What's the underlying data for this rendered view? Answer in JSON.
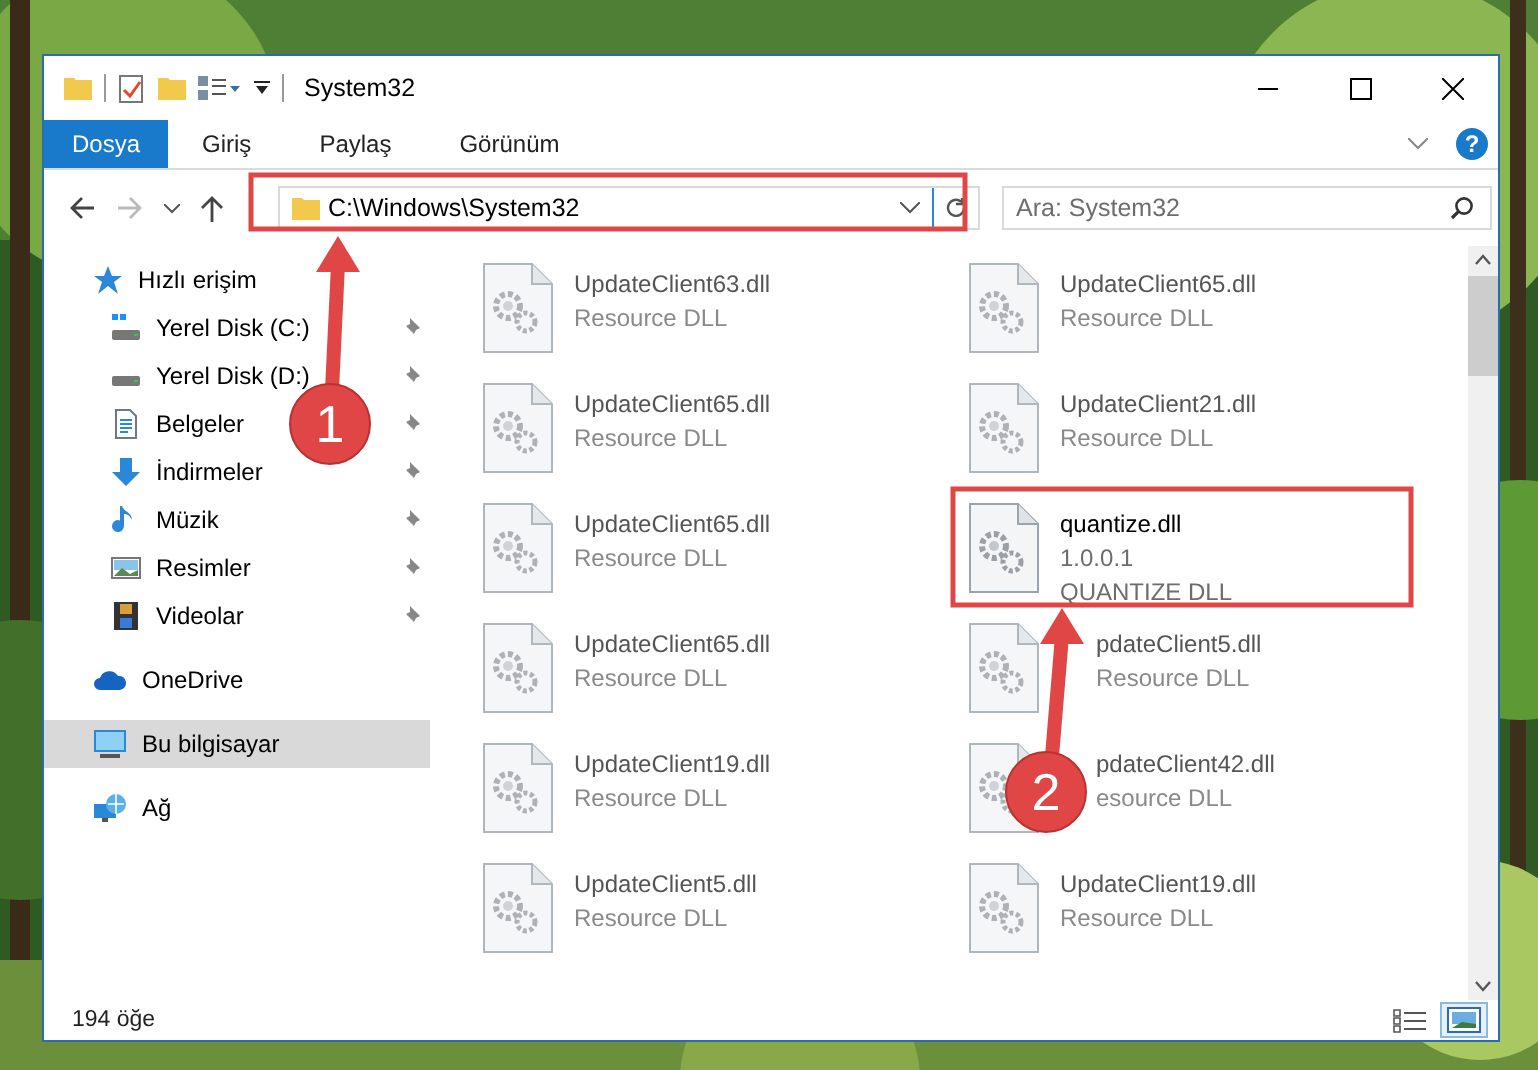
{
  "window": {
    "title": "System32"
  },
  "ribbon_tabs": [
    {
      "label": "Dosya",
      "selected": true
    },
    {
      "label": "Giriş",
      "selected": false
    },
    {
      "label": "Paylaş",
      "selected": false
    },
    {
      "label": "Görünüm",
      "selected": false
    }
  ],
  "help": "?",
  "address": {
    "value": "C:\\Windows\\System32"
  },
  "search": {
    "placeholder": "Ara: System32"
  },
  "sidebar": {
    "items": [
      {
        "kind": "quick-access",
        "label": "Hızlı erişim",
        "selected": false,
        "children": [
          {
            "kind": "disk-c",
            "label": "Yerel Disk (C:)",
            "pinned": true
          },
          {
            "kind": "disk",
            "label": "Yerel Disk (D:)",
            "pinned": true
          },
          {
            "kind": "documents",
            "label": "Belgeler",
            "pinned": true
          },
          {
            "kind": "downloads",
            "label": "İndirmeler",
            "pinned": true
          },
          {
            "kind": "music",
            "label": "Müzik",
            "pinned": true
          },
          {
            "kind": "pictures",
            "label": "Resimler",
            "pinned": true
          },
          {
            "kind": "videos",
            "label": "Videolar",
            "pinned": true
          }
        ]
      },
      {
        "kind": "cloud",
        "label": "OneDrive",
        "selected": false
      },
      {
        "kind": "computer",
        "label": "Bu bilgisayar",
        "selected": true
      },
      {
        "kind": "network",
        "label": "Ağ",
        "selected": false
      }
    ]
  },
  "files": [
    {
      "name": "UpdateClient63.dll",
      "details": [
        "Resource DLL"
      ],
      "dimmed": true
    },
    {
      "name": "UpdateClient65.dll",
      "details": [
        "Resource DLL"
      ],
      "dimmed": true
    },
    {
      "name": "UpdateClient65.dll",
      "details": [
        "Resource DLL"
      ],
      "dimmed": true
    },
    {
      "name": "UpdateClient21.dll",
      "details": [
        "Resource DLL"
      ],
      "dimmed": true
    },
    {
      "name": "UpdateClient65.dll",
      "details": [
        "Resource DLL"
      ],
      "dimmed": true
    },
    {
      "name": "quantize.dll",
      "details": [
        "1.0.0.1",
        "QUANTIZE DLL"
      ],
      "dimmed": false
    },
    {
      "name": "UpdateClient65.dll",
      "details": [
        "Resource DLL"
      ],
      "dimmed": true
    },
    {
      "name": "pdateClient5.dll",
      "details": [
        "Resource DLL"
      ],
      "dimmed": true
    },
    {
      "name": "UpdateClient19.dll",
      "details": [
        "Resource DLL"
      ],
      "dimmed": true
    },
    {
      "name": "pdateClient42.dll",
      "details": [
        "esource DLL"
      ],
      "dimmed": true
    },
    {
      "name": "UpdateClient5.dll",
      "details": [
        "Resource DLL"
      ],
      "dimmed": true
    },
    {
      "name": "UpdateClient19.dll",
      "details": [
        "Resource DLL"
      ],
      "dimmed": true
    }
  ],
  "status_bar": {
    "count": "194 öğe",
    "view_buttons": [
      {
        "kind": "details",
        "selected": false
      },
      {
        "kind": "large-icons",
        "selected": true
      }
    ]
  },
  "annotation_steps": [
    {
      "label": "1"
    },
    {
      "label": "2"
    }
  ]
}
